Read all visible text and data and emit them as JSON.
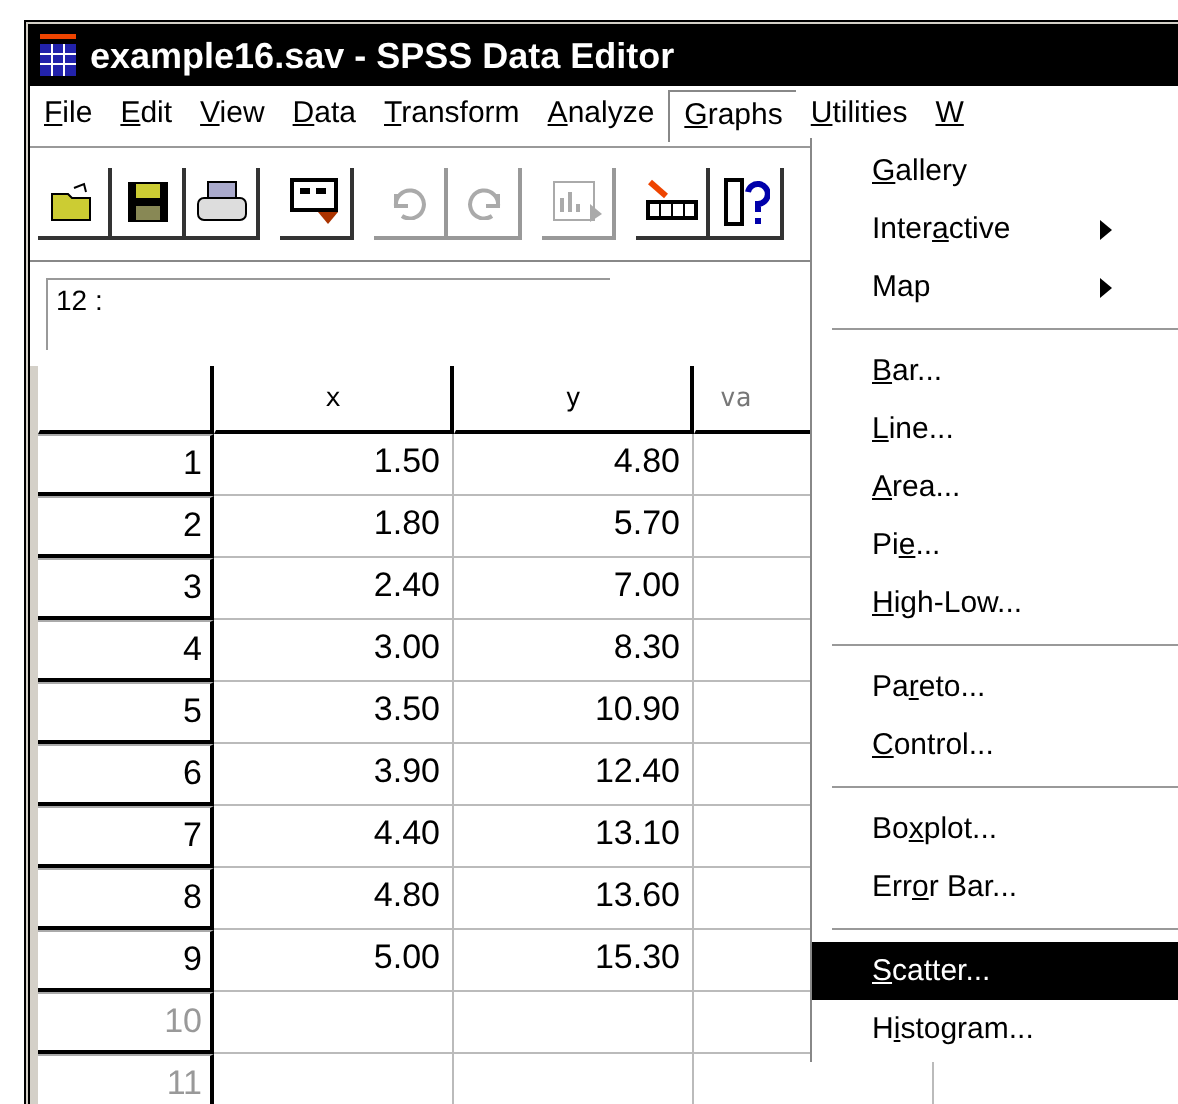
{
  "window": {
    "title": "example16.sav - SPSS Data Editor"
  },
  "menu_bar": [
    {
      "key": "F",
      "post": "ile",
      "selected": false
    },
    {
      "key": "E",
      "post": "dit",
      "selected": false
    },
    {
      "key": "V",
      "post": "iew",
      "selected": false
    },
    {
      "key": "D",
      "post": "ata",
      "selected": false
    },
    {
      "key": "T",
      "post": "ransform",
      "selected": false
    },
    {
      "key": "A",
      "post": "nalyze",
      "selected": false
    },
    {
      "key": "G",
      "post": "raphs",
      "selected": true
    },
    {
      "key": "U",
      "post": "tilities",
      "selected": false
    },
    {
      "key": "W",
      "selected": false
    }
  ],
  "toolbar": [
    {
      "kind": "open"
    },
    {
      "kind": "save"
    },
    {
      "kind": "print"
    },
    {
      "kind": "dialog"
    },
    {
      "kind": "undo",
      "disabled": true
    },
    {
      "kind": "redo",
      "disabled": true
    },
    {
      "kind": "chart",
      "disabled": true
    },
    {
      "kind": "insert"
    },
    {
      "kind": "info"
    }
  ],
  "cell_editor": {
    "label": "12 :"
  },
  "table": {
    "columns": [
      "x",
      "y",
      "va"
    ],
    "rows": [
      {
        "label": "1",
        "greyed": false,
        "cells": [
          "1.50",
          "4.80"
        ]
      },
      {
        "label": "2",
        "greyed": false,
        "cells": [
          "1.80",
          "5.70"
        ]
      },
      {
        "label": "3",
        "greyed": false,
        "cells": [
          "2.40",
          "7.00"
        ]
      },
      {
        "label": "4",
        "greyed": false,
        "cells": [
          "3.00",
          "8.30"
        ]
      },
      {
        "label": "5",
        "greyed": false,
        "cells": [
          "3.50",
          "10.90"
        ]
      },
      {
        "label": "6",
        "greyed": false,
        "cells": [
          "3.90",
          "12.40"
        ]
      },
      {
        "label": "7",
        "greyed": false,
        "cells": [
          "4.40",
          "13.10"
        ]
      },
      {
        "label": "8",
        "greyed": false,
        "cells": [
          "4.80",
          "13.60"
        ]
      },
      {
        "label": "9",
        "greyed": false,
        "cells": [
          "5.00",
          "15.30"
        ]
      },
      {
        "label": "10",
        "greyed": true
      },
      {
        "label": "11",
        "greyed": true
      }
    ]
  },
  "graphs_menu": [
    {
      "kind": "item",
      "key": "G",
      "post": "allery",
      "selected": false
    },
    {
      "kind": "item",
      "pre": "Inter",
      "key": "a",
      "post": "ctive",
      "submenu": true,
      "selected": false
    },
    {
      "kind": "item",
      "pre": "Map",
      "submenu": true,
      "selected": false
    },
    {
      "kind": "separator"
    },
    {
      "kind": "item",
      "key": "B",
      "post": "ar...",
      "selected": false
    },
    {
      "kind": "item",
      "key": "L",
      "post": "ine...",
      "selected": false
    },
    {
      "kind": "item",
      "key": "A",
      "post": "rea...",
      "selected": false
    },
    {
      "kind": "item",
      "pre": "Pi",
      "key": "e",
      "post": "...",
      "selected": false
    },
    {
      "kind": "item",
      "key": "H",
      "post": "igh-Low...",
      "selected": false
    },
    {
      "kind": "separator"
    },
    {
      "kind": "item",
      "pre": "Pa",
      "key": "r",
      "post": "eto...",
      "selected": false
    },
    {
      "kind": "item",
      "key": "C",
      "post": "ontrol...",
      "selected": false
    },
    {
      "kind": "separator"
    },
    {
      "kind": "item",
      "pre": "Bo",
      "key": "x",
      "post": "plot...",
      "selected": false
    },
    {
      "kind": "item",
      "pre": "Err",
      "key": "o",
      "post": "r Bar...",
      "selected": false
    },
    {
      "kind": "separator"
    },
    {
      "kind": "item",
      "key": "S",
      "post": "catter...",
      "selected": true
    },
    {
      "kind": "item",
      "pre": "H",
      "key": "i",
      "post": "stogram...",
      "selected": false
    }
  ]
}
